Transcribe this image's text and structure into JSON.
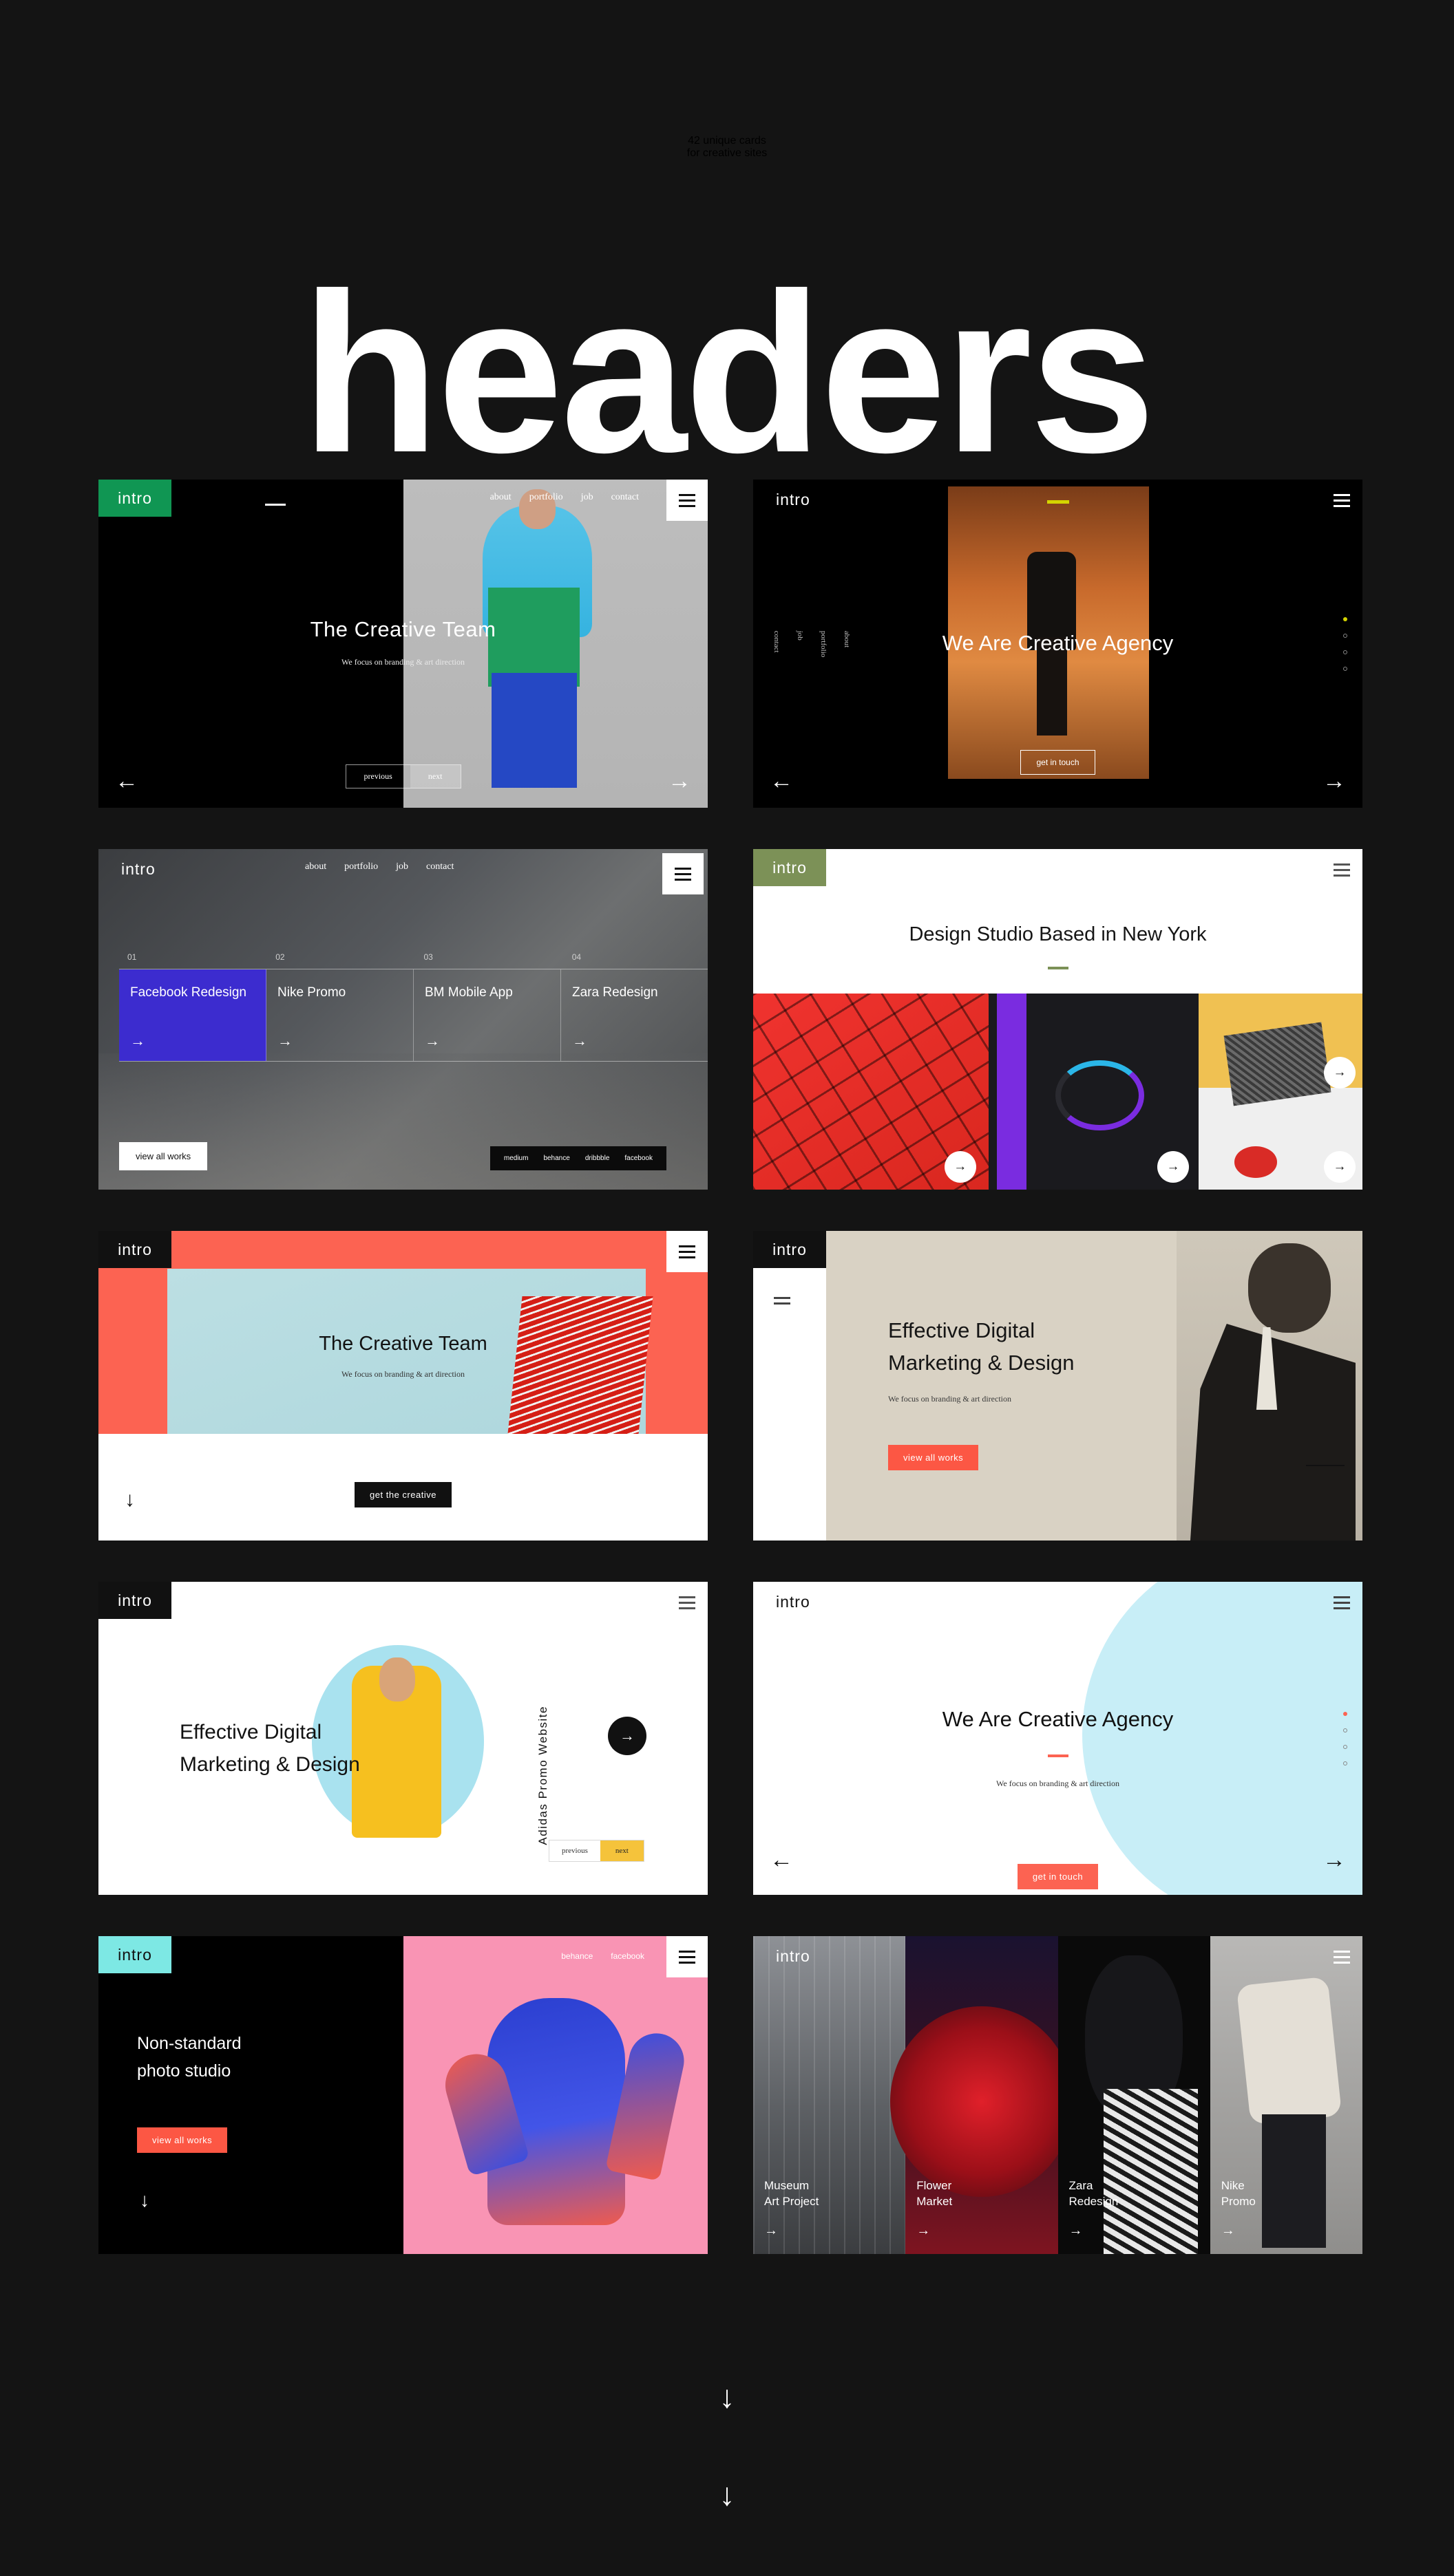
{
  "hero": {
    "line1": "42 unique cards",
    "line2": "for creative sites",
    "bigword": "headers",
    "accent_red": "#f4543c",
    "background": "#141414"
  },
  "bottom": {
    "arrow1": "↓",
    "arrow2": "↓"
  },
  "common": {
    "brand": "intro",
    "burger": "hamburger-menu",
    "arrow_left": "←",
    "arrow_right": "→",
    "arrow_down": "↓",
    "subtitle": "We focus on branding & art direction"
  },
  "cards": [
    {
      "id": "creative-team-split",
      "badge": "intro",
      "badge_color": "#109653",
      "nav": [
        "about",
        "portfolio",
        "job",
        "contact"
      ],
      "title": "The Creative Team",
      "subtitle": "We focus on branding & art direction",
      "prev_label": "previous",
      "next_label": "next",
      "arrow_left": "←",
      "arrow_right": "→"
    },
    {
      "id": "creative-agency-dark",
      "badge": "intro",
      "nav": [
        "about",
        "portfolio",
        "job",
        "contact"
      ],
      "title": "We Are Creative Agency",
      "cta": "get in touch",
      "dash_color": "#d4d400",
      "dots": 4,
      "active_dot": 1,
      "arrow_left": "←",
      "arrow_right": "→"
    },
    {
      "id": "projects-office",
      "badge": "intro",
      "nav": [
        "about",
        "portfolio",
        "job",
        "contact"
      ],
      "projects": [
        {
          "num": "01",
          "label": "Facebook Redesign",
          "active": true
        },
        {
          "num": "02",
          "label": "Nike Promo",
          "active": false
        },
        {
          "num": "03",
          "label": "BM Mobile App",
          "active": false
        },
        {
          "num": "04",
          "label": "Zara Redesign",
          "active": false
        }
      ],
      "active_color": "#3c2ccf",
      "cta": "view all works",
      "social": [
        "medium",
        "behance",
        "dribbble",
        "facebook"
      ]
    },
    {
      "id": "design-studio-new-york",
      "badge": "intro",
      "badge_color": "#7c9157",
      "title": "Design Studio Based in New York",
      "divider_color": "#7c9157",
      "tiles": 3,
      "tile_arrow": "→"
    },
    {
      "id": "creative-team-coral",
      "badge": "intro",
      "badge_color": "#111111",
      "frame_color": "#fc6352",
      "title": "The Creative Team",
      "subtitle": "We focus on branding & art direction",
      "cta": "get the creative",
      "arrow_down": "↓"
    },
    {
      "id": "effective-digital-marketing-beige",
      "badge": "intro",
      "badge_color": "#111111",
      "bg_color": "#d9d2c4",
      "title_line1": "Effective Digital",
      "title_line2": "Marketing & Design",
      "subtitle": "We focus on branding & art direction",
      "cta": "view all works",
      "cta_color": "#fc5744"
    },
    {
      "id": "adidas-promo-circle",
      "badge": "intro",
      "badge_color": "#111111",
      "title_line1": "Effective Digital",
      "title_line2": "Marketing & Design",
      "vertical_label": "Adidas Promo Website",
      "circle_arrow": "→",
      "prev_label": "previous",
      "next_label": "next",
      "next_color": "#f5c33b"
    },
    {
      "id": "creative-agency-blue-circle",
      "badge": "intro",
      "title": "We Are Creative Agency",
      "divider_color": "#fc6352",
      "subtitle": "We focus on branding & art direction",
      "cta": "get in touch",
      "cta_color": "#fc6352",
      "circle_color": "#c8eef7",
      "dots": 4,
      "active_dot": 1,
      "arrow_left": "←",
      "arrow_right": "→"
    },
    {
      "id": "non-standard-photo-studio",
      "badge": "intro",
      "badge_color": "#7de8e4",
      "title_line1": "Non-standard",
      "title_line2": "photo studio",
      "cta": "view all works",
      "cta_color": "#fc5744",
      "nav": [
        "behance",
        "facebook"
      ],
      "arrow_down": "↓"
    },
    {
      "id": "four-projects-strip",
      "badge": "intro",
      "projects": [
        {
          "line1": "Museum",
          "line2": "Art Project",
          "arrow": "→"
        },
        {
          "line1": "Flower",
          "line2": "Market",
          "arrow": "→"
        },
        {
          "line1": "Zara",
          "line2": "Redesign",
          "arrow": "→"
        },
        {
          "line1": "Nike",
          "line2": "Promo",
          "arrow": "→"
        }
      ]
    }
  ]
}
